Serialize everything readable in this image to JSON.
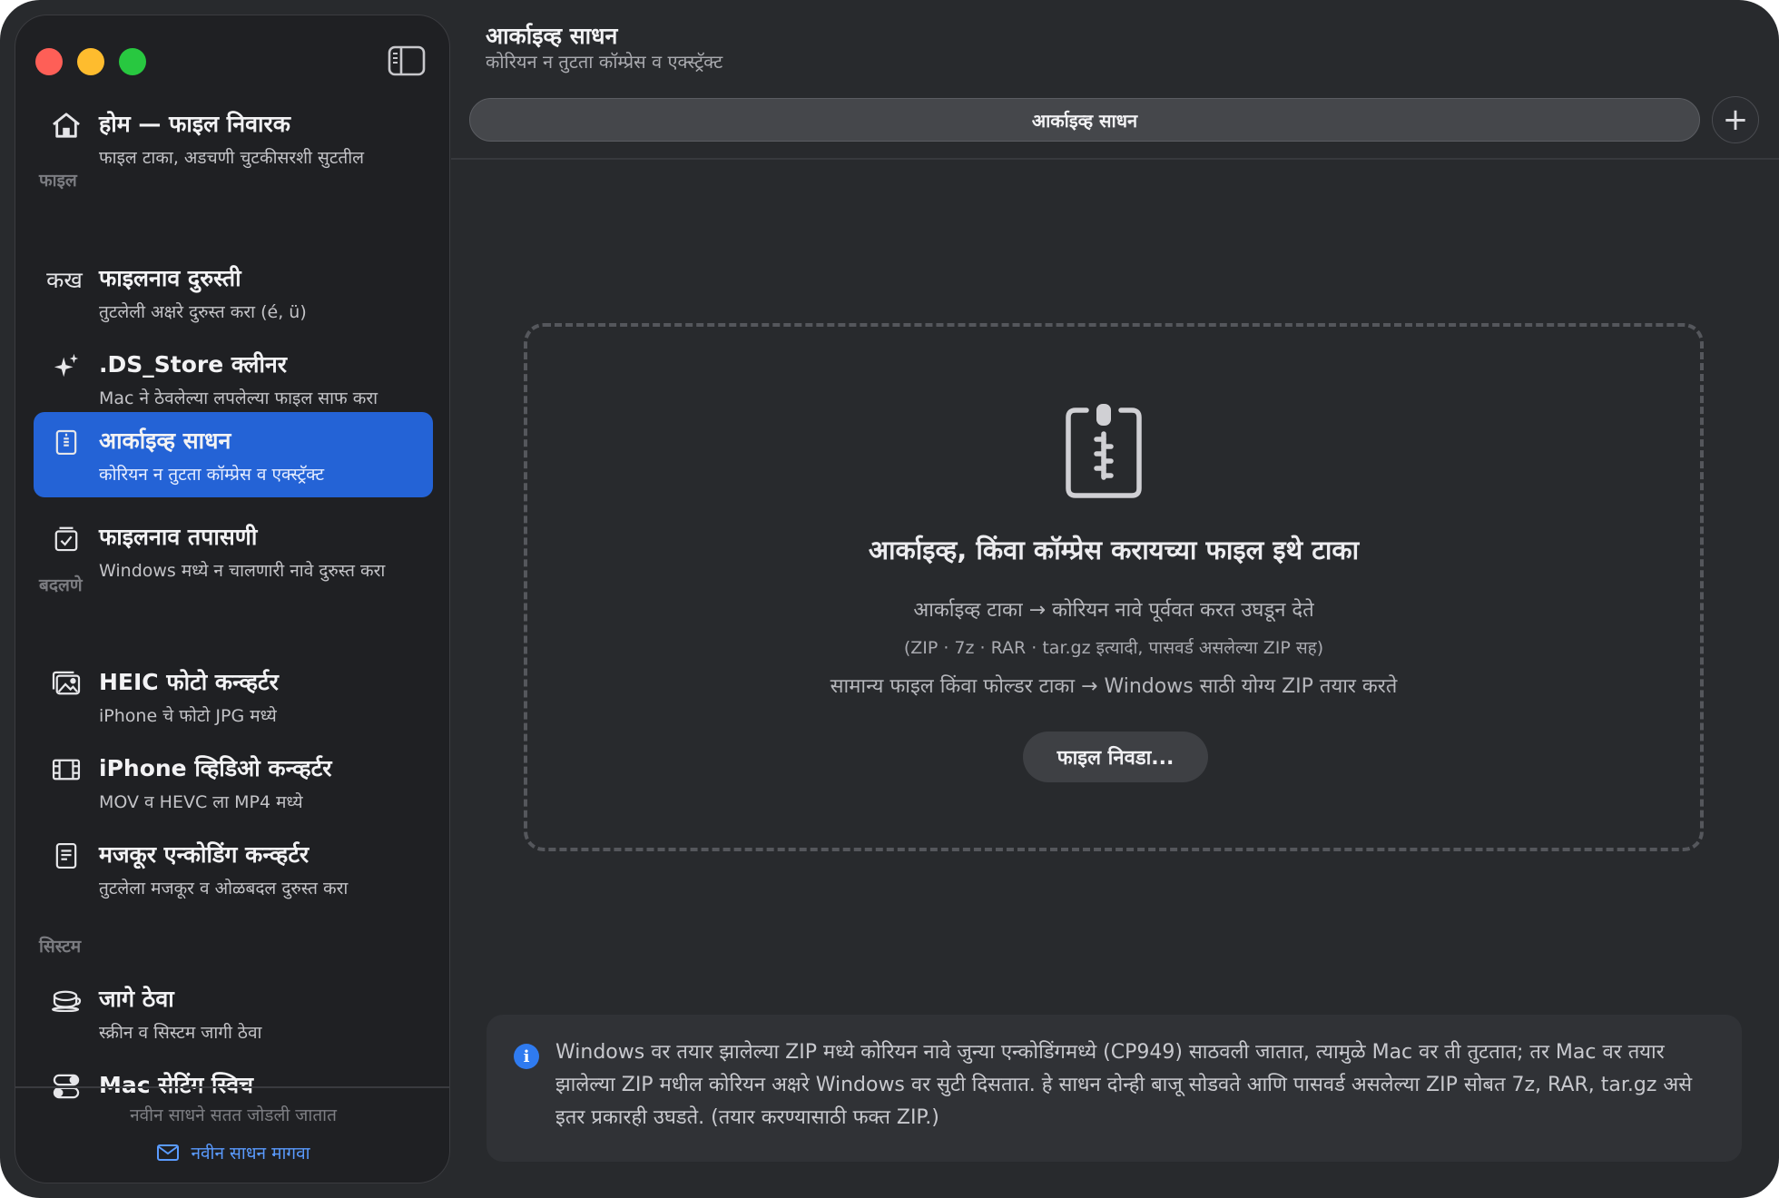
{
  "sidebar": {
    "items": [
      {
        "icon": "house-icon",
        "title": "होम — फाइल निवारक",
        "subtitle": "फाइल टाका, अडचणी चुटकीसरशी सुटतील"
      },
      {
        "icon": "kakha-text-icon",
        "glyph": "कख",
        "title": "फाइलनाव दुरुस्ती",
        "subtitle": "तुटलेली अक्षरे दुरुस्त करा (é, ü)"
      },
      {
        "icon": "sparkles-icon",
        "title": ".DS_Store क्लीनर",
        "subtitle": "Mac ने ठेवलेल्या लपलेल्या फाइल साफ करा"
      },
      {
        "icon": "zip-archive-icon",
        "title": "आर्काइव्ह साधन",
        "subtitle": "कोरियन न तुटता कॉम्प्रेस व एक्स्ट्रॅक्ट"
      },
      {
        "icon": "checklist-icon",
        "title": "फाइलनाव तपासणी",
        "subtitle": "Windows मध्ये न चालणारी नावे दुरुस्त करा"
      },
      {
        "icon": "photo-stack-icon",
        "title": "HEIC फोटो कन्व्हर्टर",
        "subtitle": "iPhone चे फोटो JPG मध्ये"
      },
      {
        "icon": "film-icon",
        "title": "iPhone व्हिडिओ कन्व्हर्टर",
        "subtitle": "MOV व HEVC ला MP4 मध्ये"
      },
      {
        "icon": "document-text-icon",
        "title": "मजकूर एन्कोडिंग कन्व्हर्टर",
        "subtitle": "तुटलेला मजकूर व ओळबदल दुरुस्त करा"
      },
      {
        "icon": "coffee-cup-icon",
        "title": "जागे ठेवा",
        "subtitle": "स्क्रीन व सिस्टम जागी ठेवा"
      },
      {
        "icon": "toggle-switches-icon",
        "title": "Mac सेटिंग स्विच",
        "subtitle": ""
      }
    ],
    "sections": {
      "files": "फाइल",
      "convert": "बदलणे",
      "system": "सिस्टम"
    },
    "footer_note": "नवीन साधने सतत जोडली जातात",
    "request_link": "नवीन साधन मागवा"
  },
  "header": {
    "title": "आर्काइव्ह साधन",
    "subtitle": "कोरियन न तुटता कॉम्प्रेस व एक्स्ट्रॅक्ट",
    "tab_label": "आर्काइव्ह साधन",
    "add_glyph": "+"
  },
  "dropzone": {
    "title": "आर्काइव्ह, किंवा कॉम्प्रेस करायच्या फाइल इथे टाका",
    "line1": "आर्काइव्ह टाका → कोरियन नावे पूर्ववत करत उघडून देते",
    "line2": "(ZIP · 7z · RAR · tar.gz इत्यादी, पासवर्ड असलेल्या ZIP सह)",
    "line3": "सामान्य फाइल किंवा फोल्डर टाका → Windows साठी योग्य ZIP तयार करते",
    "button": "फाइल निवडा..."
  },
  "info": {
    "icon_glyph": "i",
    "text": "Windows वर तयार झालेल्या ZIP मध्ये कोरियन नावे जुन्या एन्कोडिंगमध्ये (CP949) साठवली जातात, त्यामुळे Mac वर ती तुटतात; तर Mac वर तयार झालेल्या ZIP मधील कोरियन अक्षरे Windows वर सुटी दिसतात. हे साधन दोन्ही बाजू सोडवते आणि पासवर्ड असलेल्या ZIP सोबत 7z, RAR, tar.gz असे इतर प्रकारही उघडते. (तयार करण्यासाठी फक्त ZIP.)"
  },
  "colors": {
    "window_bg": "#282a2d",
    "sidebar_bg": "#1f2023",
    "active_item": "#2463d6",
    "link": "#5a9bff",
    "info_icon": "#2f7bf0",
    "traffic_red": "#fe5f57",
    "traffic_yellow": "#febc2e",
    "traffic_green": "#28c840"
  }
}
